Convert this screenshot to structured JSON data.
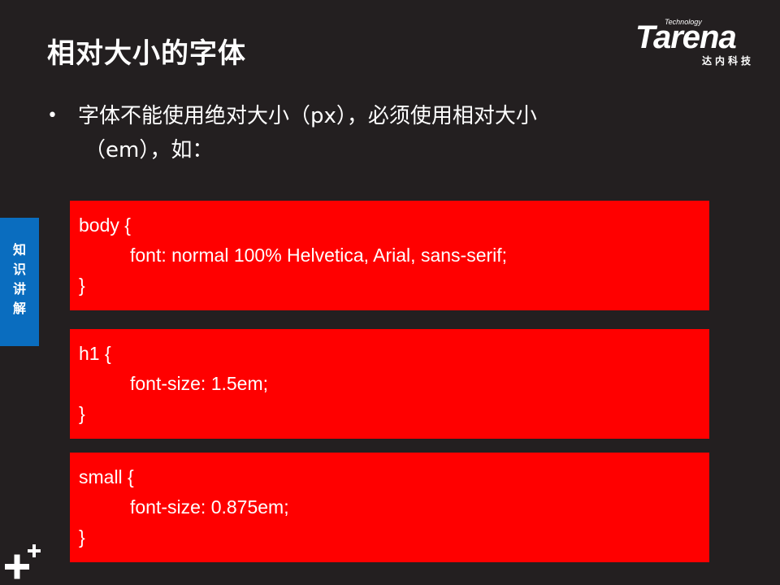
{
  "slide": {
    "title": "相对大小的字体",
    "logo": {
      "word": "Tarena",
      "tagline": "Technology",
      "sub": "达内科技"
    },
    "side_tab": {
      "label": "知识讲解"
    },
    "bullet": {
      "line1": "字体不能使用绝对大小（px），必须使用相对大小",
      "line2": "（em），如："
    },
    "code_blocks": [
      {
        "selector_line": "body {",
        "rule_line": "font: normal 100% Helvetica, Arial, sans-serif;",
        "close_line": "}"
      },
      {
        "selector_line": "h1 {",
        "rule_line": "font-size: 1.5em;",
        "close_line": "}"
      },
      {
        "selector_line": "small {",
        "rule_line": "font-size: 0.875em;",
        "close_line": "}"
      }
    ]
  },
  "colors": {
    "background": "#231f20",
    "code_box": "#ff0000",
    "side_tab": "#0a6dbf",
    "text": "#ffffff"
  },
  "icons": {
    "bullet": "bullet-dot",
    "corner": "plus-plus-icon"
  }
}
